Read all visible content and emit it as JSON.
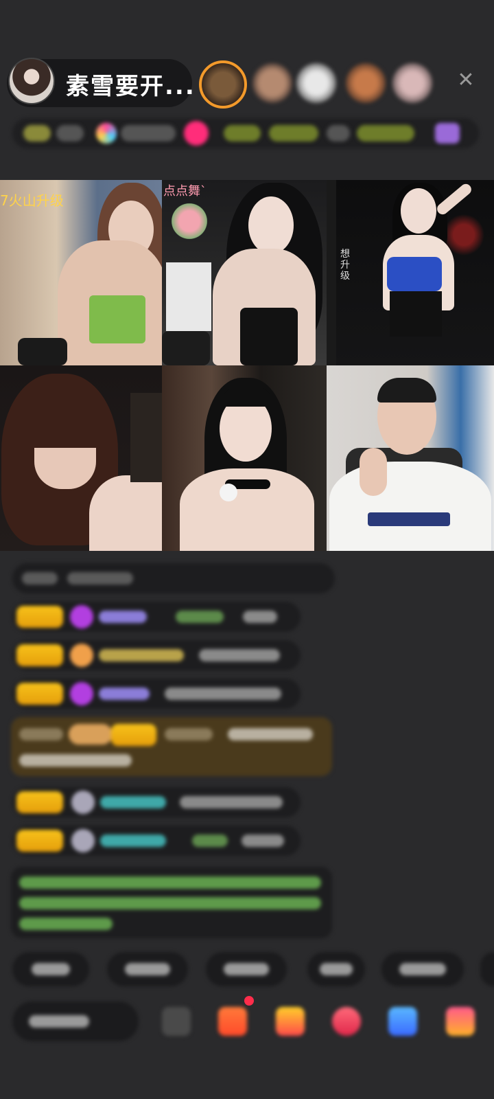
{
  "header": {
    "host_name": "素雪要开...",
    "close_icon": "close-icon"
  },
  "grid": {
    "cells": [
      {
        "caption": "7火山升级"
      },
      {
        "caption": "点点舞`"
      },
      {
        "caption": "想升级"
      },
      {
        "caption": ""
      },
      {
        "caption": ""
      },
      {
        "caption": ""
      }
    ]
  },
  "colors": {
    "background": "#2a2a2c",
    "badge_gold": "#f7c21a",
    "accent_pink": "#ff2d7a",
    "text_green": "#7bd15a",
    "text_teal": "#3fc7c0"
  }
}
